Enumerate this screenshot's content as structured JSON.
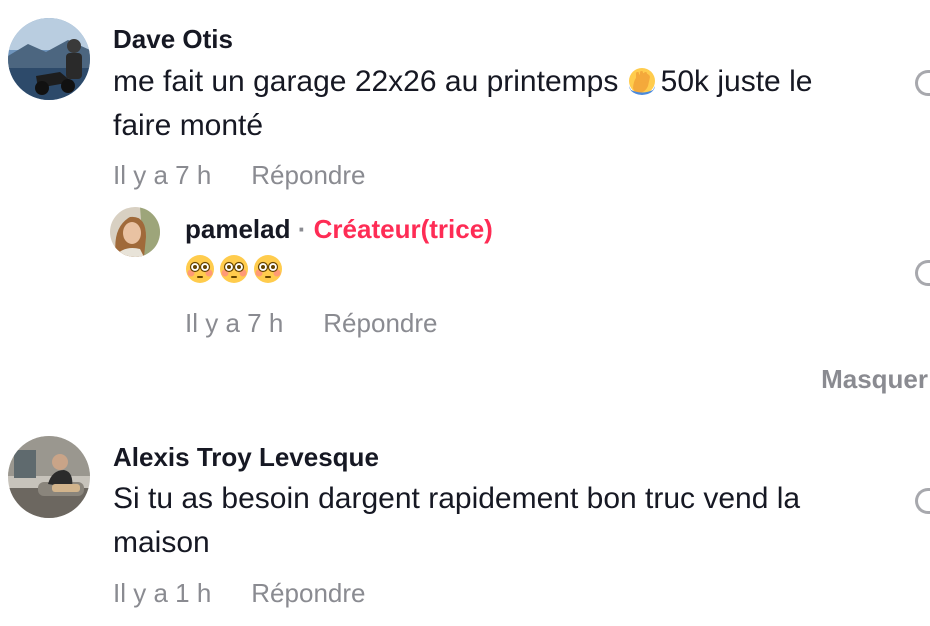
{
  "comments": [
    {
      "author": "Dave Otis",
      "text_before_emoji": "me fait un garage 22x26 au printemps ",
      "emoji": "facepalm-emoji",
      "text_after_emoji": "50k juste le",
      "text_line2": "faire monté",
      "time": "Il y a 7 h",
      "reply_label": "Répondre",
      "reply": {
        "author": "pamelad",
        "separator": "·",
        "badge": "Créateur(trice)",
        "emojis": [
          "flushed-face-emoji",
          "flushed-face-emoji",
          "flushed-face-emoji"
        ],
        "time": "Il y a 7 h",
        "reply_label": "Répondre"
      }
    },
    {
      "author": "Alexis Troy Levesque",
      "text_line1": "Si tu as besoin dargent rapidement bon truc vend la",
      "text_line2": "maison",
      "time": "Il y a 1 h",
      "reply_label": "Répondre"
    }
  ],
  "hide_replies_label": "Masquer"
}
